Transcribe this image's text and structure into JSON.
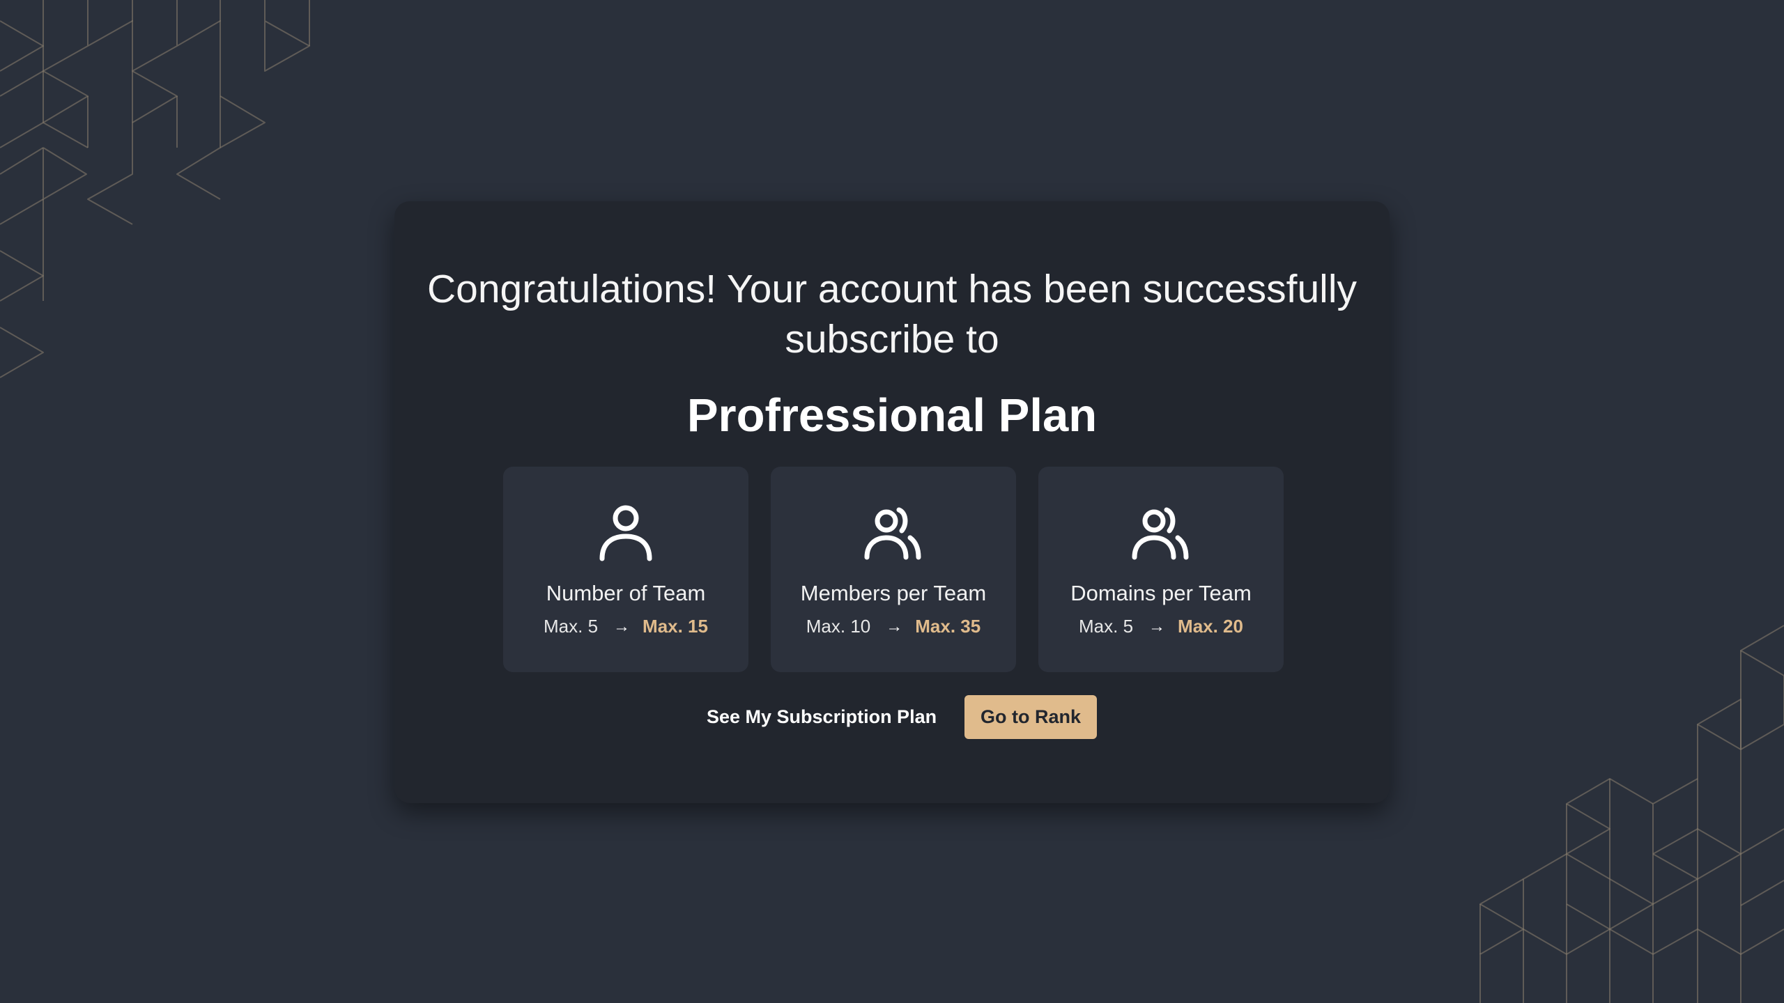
{
  "modal": {
    "headline": "Congratulations! Your account has been successfully subscribe to",
    "plan_name": "Profressional Plan"
  },
  "features": [
    {
      "icon": "user-icon",
      "title": "Number of Team",
      "old_value": "Max. 5",
      "new_value": "Max. 15"
    },
    {
      "icon": "users-icon",
      "title": "Members per Team",
      "old_value": "Max. 10",
      "new_value": "Max. 35"
    },
    {
      "icon": "users-icon",
      "title": "Domains per Team",
      "old_value": "Max. 5",
      "new_value": "Max. 20"
    }
  ],
  "arrow_glyph": "→",
  "actions": {
    "secondary_label": "See My Subscription Plan",
    "primary_label": "Go to Rank"
  },
  "colors": {
    "background": "#2a303b",
    "modal": "#22262e",
    "card": "#2c313c",
    "accent": "#e0bb8c",
    "pattern_line": "#8a8070"
  }
}
